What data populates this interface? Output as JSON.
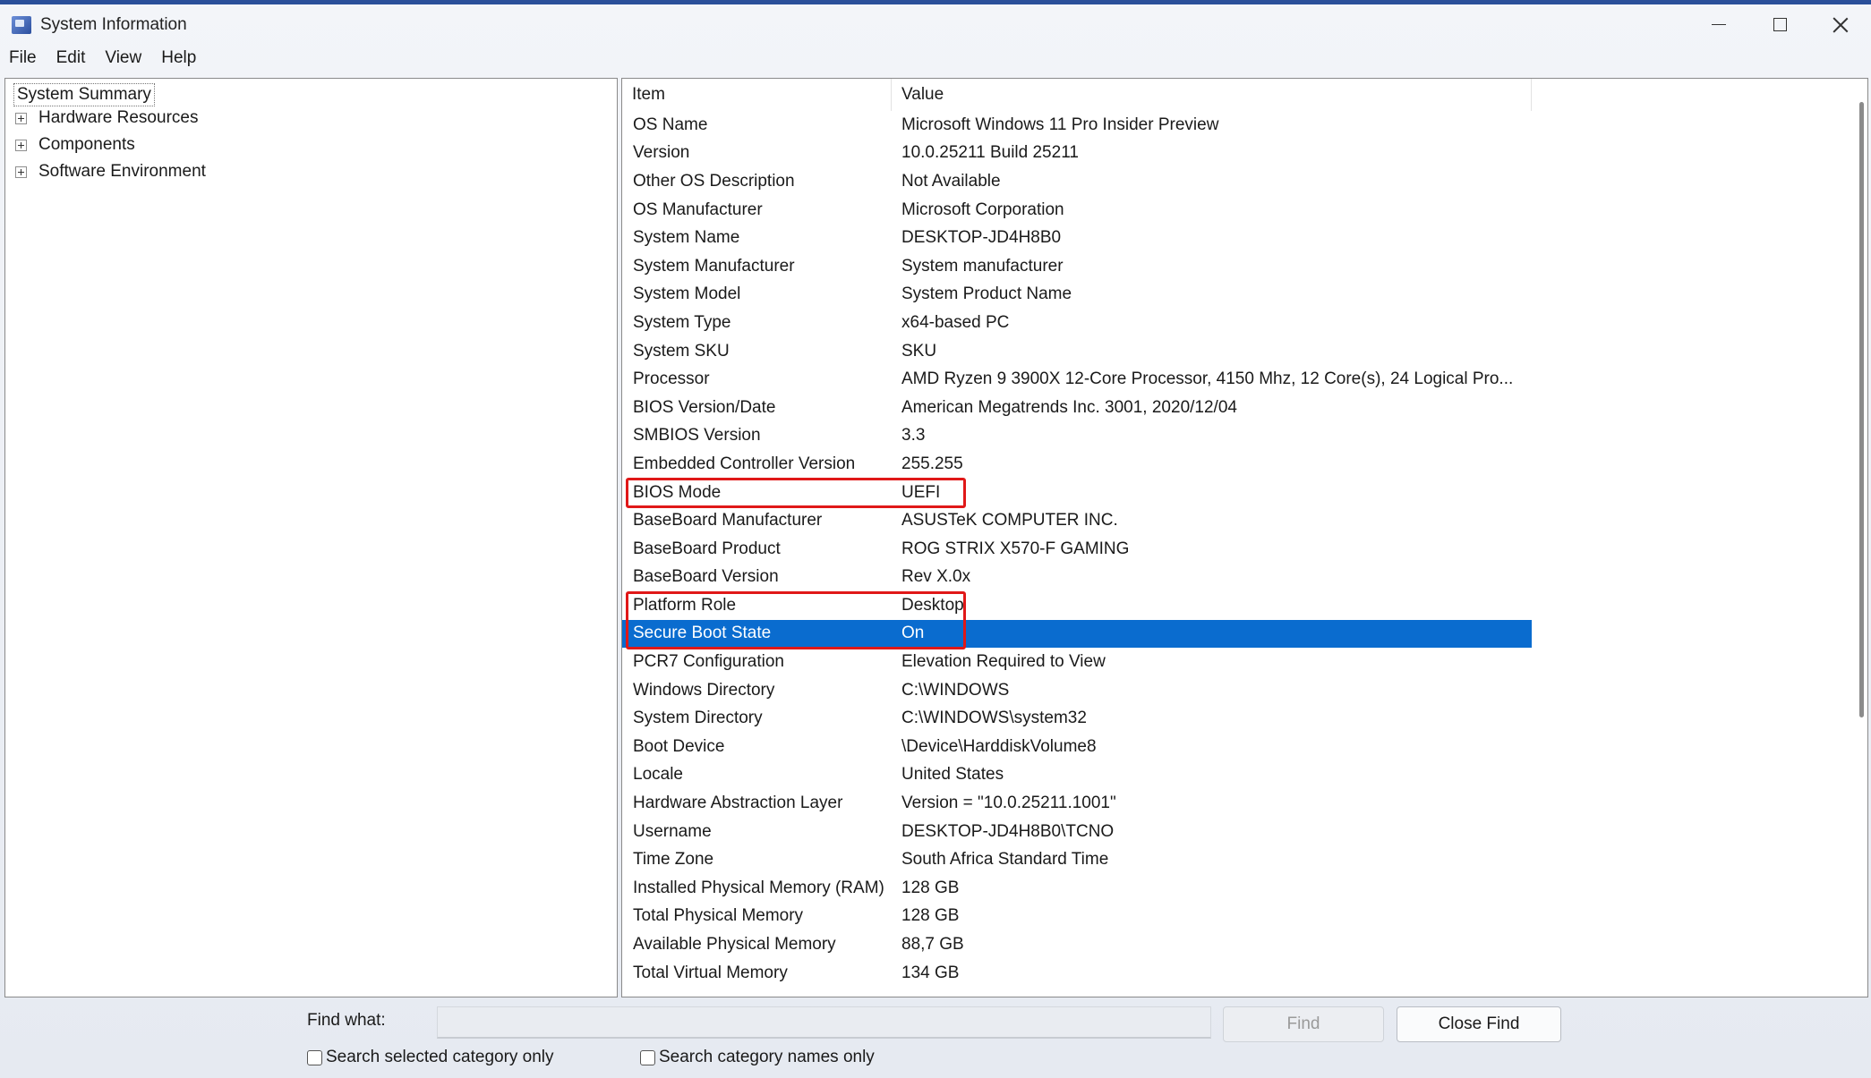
{
  "window": {
    "title": "System Information",
    "controls": [
      "minimize",
      "maximize",
      "close"
    ]
  },
  "menu": [
    "File",
    "Edit",
    "View",
    "Help"
  ],
  "tree": {
    "root": "System Summary",
    "children": [
      "Hardware Resources",
      "Components",
      "Software Environment"
    ]
  },
  "list": {
    "headers": {
      "item": "Item",
      "value": "Value"
    },
    "selected_index": 18,
    "highlighted_rows": [
      13,
      18
    ],
    "rows": [
      {
        "item": "OS Name",
        "value": "Microsoft Windows 11 Pro Insider Preview"
      },
      {
        "item": "Version",
        "value": "10.0.25211 Build 25211"
      },
      {
        "item": "Other OS Description",
        "value": "Not Available"
      },
      {
        "item": "OS Manufacturer",
        "value": "Microsoft Corporation"
      },
      {
        "item": "System Name",
        "value": "DESKTOP-JD4H8B0"
      },
      {
        "item": "System Manufacturer",
        "value": "System manufacturer"
      },
      {
        "item": "System Model",
        "value": "System Product Name"
      },
      {
        "item": "System Type",
        "value": "x64-based PC"
      },
      {
        "item": "System SKU",
        "value": "SKU"
      },
      {
        "item": "Processor",
        "value": "AMD Ryzen 9 3900X 12-Core Processor, 4150 Mhz, 12 Core(s), 24 Logical Pro..."
      },
      {
        "item": "BIOS Version/Date",
        "value": "American Megatrends Inc. 3001, 2020/12/04"
      },
      {
        "item": "SMBIOS Version",
        "value": "3.3"
      },
      {
        "item": "Embedded Controller Version",
        "value": "255.255"
      },
      {
        "item": "BIOS Mode",
        "value": "UEFI"
      },
      {
        "item": "BaseBoard Manufacturer",
        "value": "ASUSTeK COMPUTER INC."
      },
      {
        "item": "BaseBoard Product",
        "value": "ROG STRIX X570-F GAMING"
      },
      {
        "item": "BaseBoard Version",
        "value": "Rev X.0x"
      },
      {
        "item": "Platform Role",
        "value": "Desktop"
      },
      {
        "item": "Secure Boot State",
        "value": "On"
      },
      {
        "item": "PCR7 Configuration",
        "value": "Elevation Required to View"
      },
      {
        "item": "Windows Directory",
        "value": "C:\\WINDOWS"
      },
      {
        "item": "System Directory",
        "value": "C:\\WINDOWS\\system32"
      },
      {
        "item": "Boot Device",
        "value": "\\Device\\HarddiskVolume8"
      },
      {
        "item": "Locale",
        "value": "United States"
      },
      {
        "item": "Hardware Abstraction Layer",
        "value": "Version = \"10.0.25211.1001\""
      },
      {
        "item": "Username",
        "value": "DESKTOP-JD4H8B0\\TCNO"
      },
      {
        "item": "Time Zone",
        "value": "South Africa Standard Time"
      },
      {
        "item": "Installed Physical Memory (RAM)",
        "value": "128 GB"
      },
      {
        "item": "Total Physical Memory",
        "value": "128 GB"
      },
      {
        "item": "Available Physical Memory",
        "value": "88,7 GB"
      },
      {
        "item": "Total Virtual Memory",
        "value": "134 GB"
      }
    ]
  },
  "find": {
    "label": "Find what:",
    "value": "",
    "find_button": "Find",
    "close_button": "Close Find",
    "checkbox_selected": "Search selected category only",
    "checkbox_names": "Search category names only",
    "checkbox_selected_checked": false,
    "checkbox_names_checked": false
  },
  "colors": {
    "selection": "#0a6ccf",
    "highlight_box": "#e01818"
  }
}
